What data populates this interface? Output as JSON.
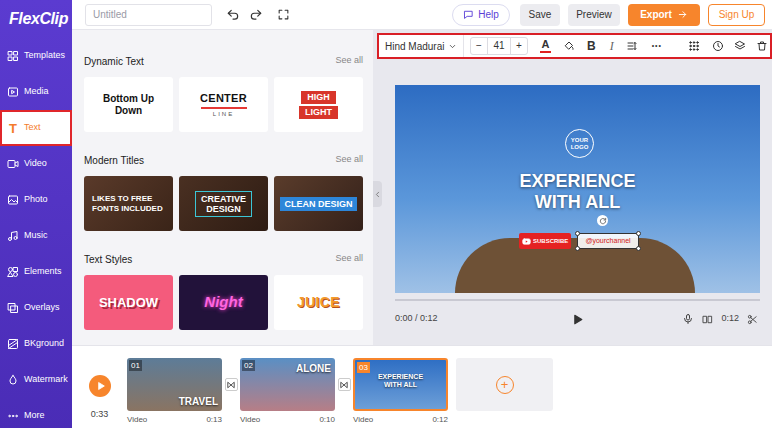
{
  "logo": {
    "text": "FlexClip"
  },
  "top_bar": {
    "title_placeholder": "Untitled",
    "help": "Help",
    "save": "Save",
    "preview": "Preview",
    "export": "Export",
    "sign_up": "Sign Up"
  },
  "sidebar": {
    "items": [
      {
        "label": "Templates",
        "selected": false
      },
      {
        "label": "Media",
        "selected": false
      },
      {
        "label": "Text",
        "selected": true,
        "icon": "T"
      },
      {
        "label": "Video",
        "selected": false
      },
      {
        "label": "Photo",
        "selected": false
      },
      {
        "label": "Music",
        "selected": false
      },
      {
        "label": "Elements",
        "selected": false
      },
      {
        "label": "Overlays",
        "selected": false
      },
      {
        "label": "BKground",
        "selected": false
      },
      {
        "label": "Watermark",
        "selected": false
      },
      {
        "label": "More",
        "selected": false
      }
    ]
  },
  "panel": {
    "sections": [
      {
        "title": "Dynamic Text",
        "see_all": "See all",
        "cards": [
          {
            "kind": "stacked",
            "lines": [
              "Bottom Up",
              "Down"
            ]
          },
          {
            "kind": "centerline",
            "lines": [
              "CENTER",
              "LINE"
            ]
          },
          {
            "kind": "highlight",
            "lines": [
              "HIGH",
              "LIGHT"
            ]
          }
        ]
      },
      {
        "title": "Modern Titles",
        "see_all": "See all",
        "cards": [
          {
            "kind": "woodtext",
            "lines": [
              "LIKES TO FREE",
              "FONTS INCLUDED"
            ]
          },
          {
            "kind": "woodframe",
            "lines": [
              "CREATIVE",
              "DESIGN"
            ]
          },
          {
            "kind": "woodbanner",
            "lines": [
              "CLEAN DESIGN"
            ]
          }
        ]
      },
      {
        "title": "Text Styles",
        "see_all": "See all",
        "cards": [
          {
            "kind": "shadow",
            "lines": [
              "SHADOW"
            ]
          },
          {
            "kind": "neon",
            "lines": [
              "Night"
            ]
          },
          {
            "kind": "juice",
            "lines": [
              "JUICE"
            ]
          }
        ]
      }
    ]
  },
  "toolbar": {
    "font": "Hind Madurai",
    "minus": "−",
    "size": "41",
    "plus": "+",
    "text_color": "A",
    "color": "#e02020",
    "bold": "B",
    "italic": "I",
    "more": "•••"
  },
  "canvas": {
    "logo_lines": [
      "YOUR",
      "LOGO"
    ],
    "headline_lines": [
      "EXPERIENCE",
      "WITH ALL"
    ],
    "subscribe": "SUBSCRIBE",
    "channel": "@yourchannel",
    "channel_selected": true
  },
  "player": {
    "time": "0:00 / 0:12",
    "level": 0,
    "duration": "0:12"
  },
  "timeline": {
    "total": "0:33",
    "add": "+",
    "clips": [
      {
        "number": "01",
        "caption": "TRAVEL",
        "kind": "bottom",
        "type": "Video",
        "duration": "0:13",
        "selected": false
      },
      {
        "number": "02",
        "caption": "ALONE",
        "kind": "top",
        "type": "Video",
        "duration": "0:10",
        "selected": false
      },
      {
        "number": "03",
        "caption": "EXPERIENCE WITH ALL",
        "kind": "center",
        "type": "Video",
        "duration": "0:12",
        "selected": true
      }
    ]
  }
}
